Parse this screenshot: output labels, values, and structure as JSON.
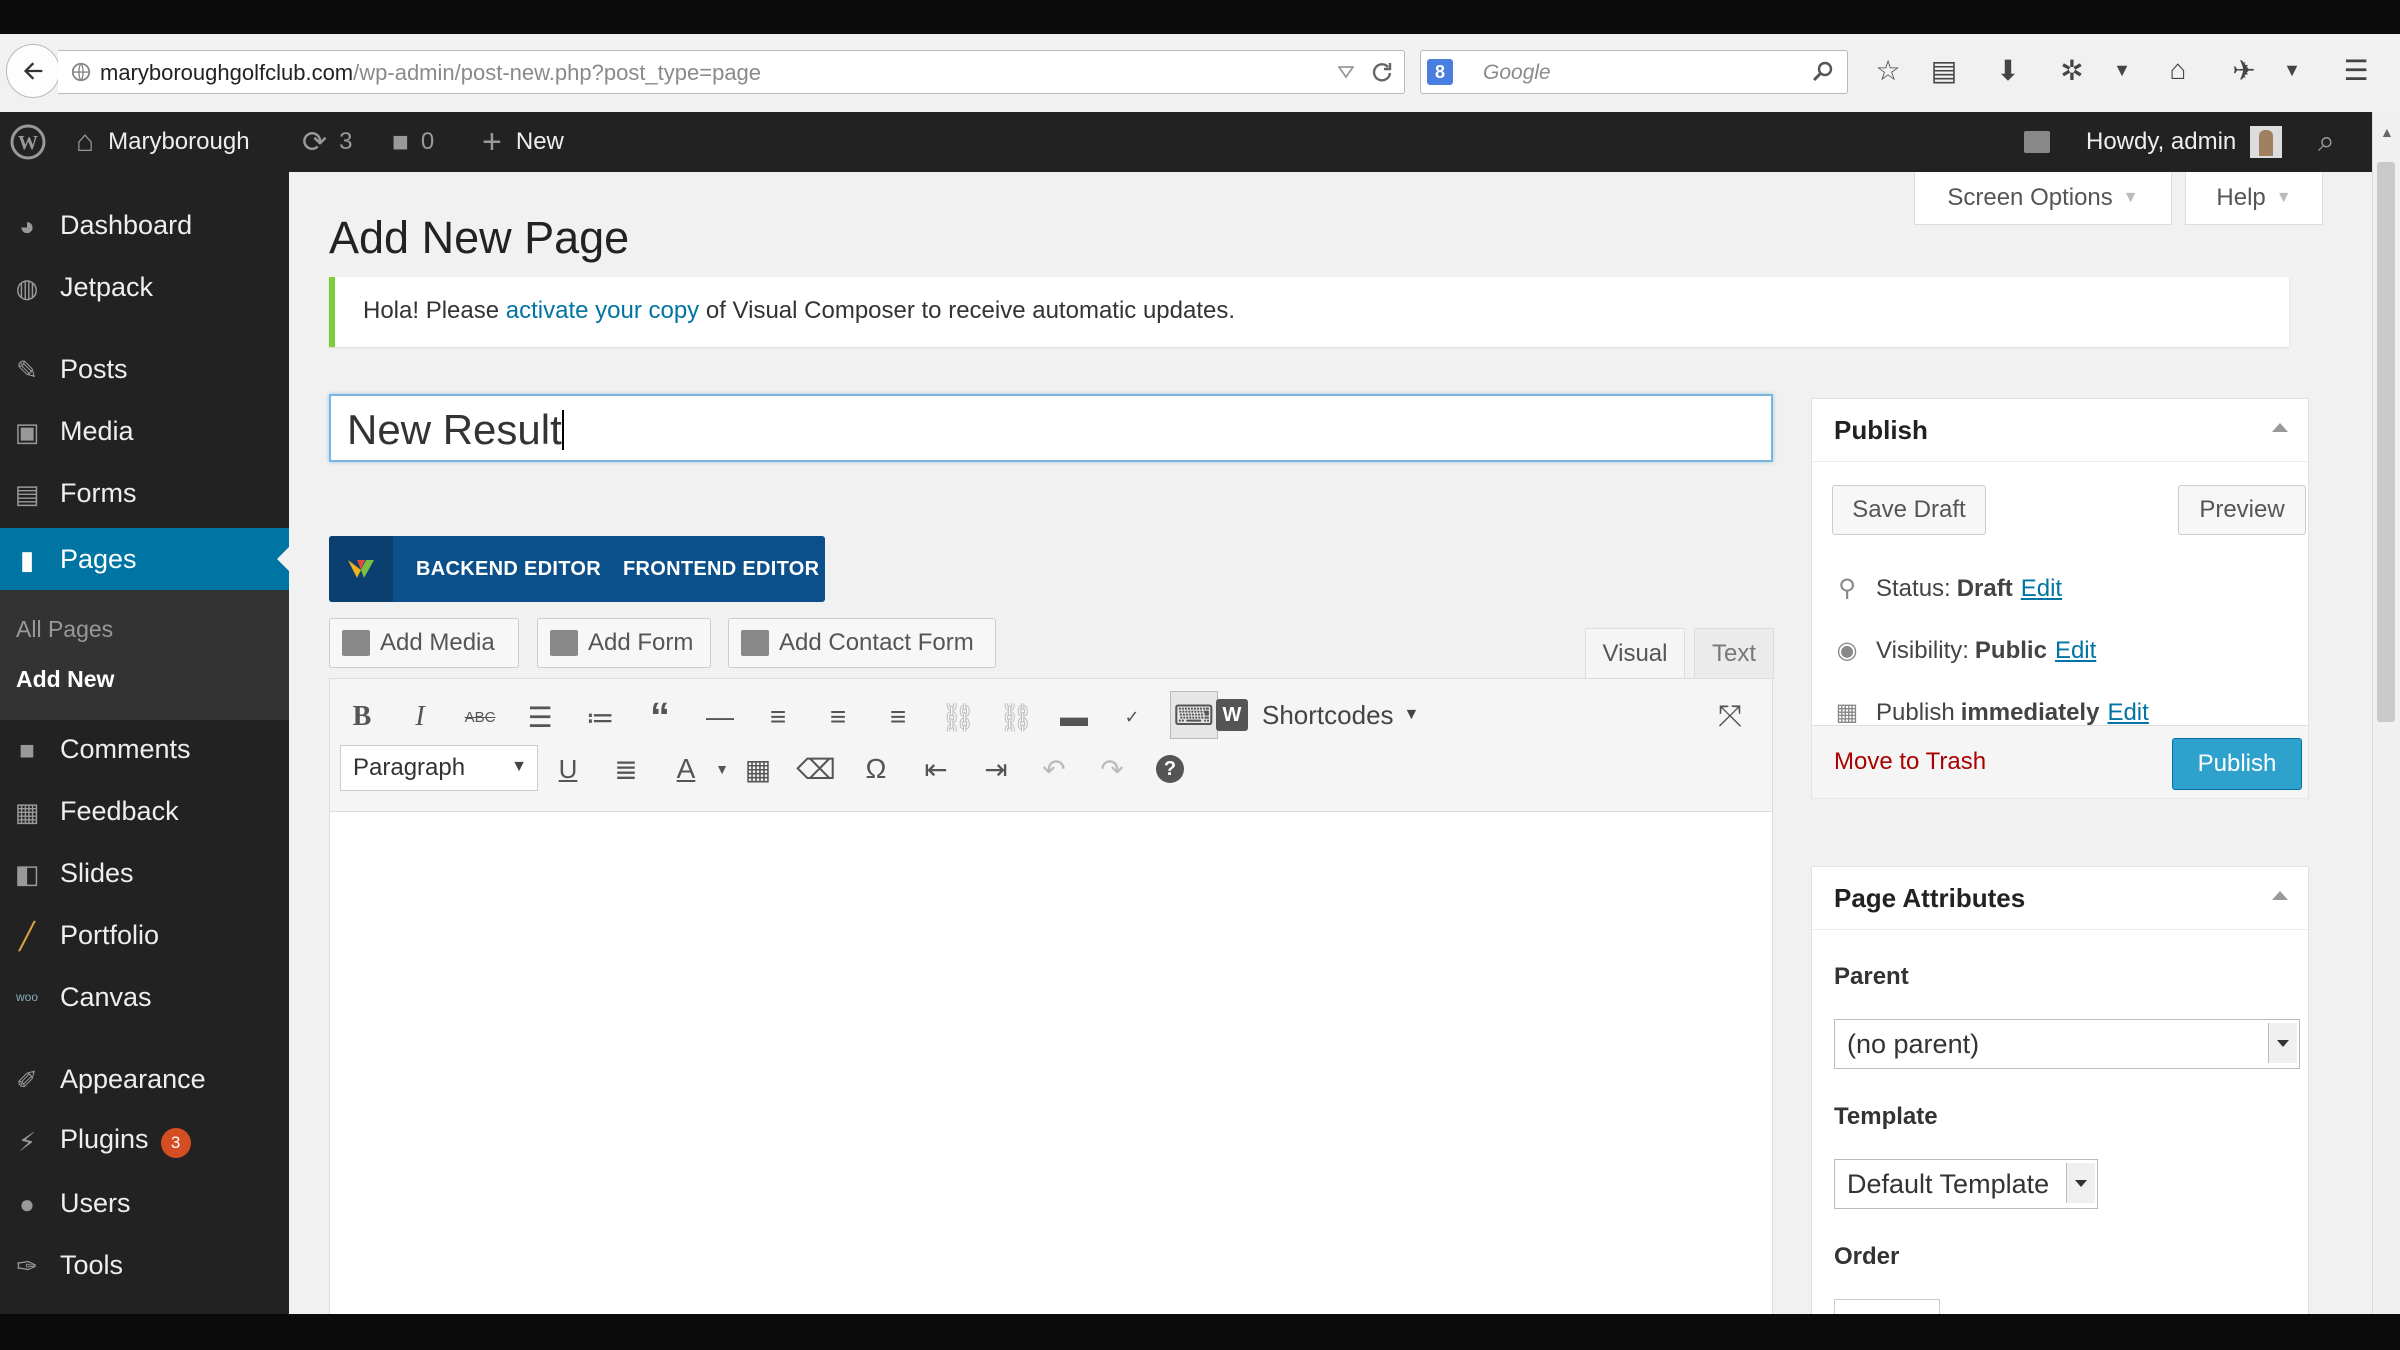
{
  "browser": {
    "url_domain": "maryboroughgolfclub.com",
    "url_path": "/wp-admin/post-new.php?post_type=page",
    "search_placeholder": "Google",
    "search_engine_label": "8"
  },
  "adminbar": {
    "site_name": "Maryborough",
    "updates_count": "3",
    "comments_count": "0",
    "new_label": "New",
    "howdy": "Howdy, admin"
  },
  "sidebar": {
    "items": [
      {
        "label": "Dashboard",
        "icon": "dashboard-icon"
      },
      {
        "label": "Jetpack",
        "icon": "jetpack-icon"
      },
      {
        "label": "Posts",
        "icon": "pin-icon"
      },
      {
        "label": "Media",
        "icon": "media-icon"
      },
      {
        "label": "Forms",
        "icon": "forms-icon"
      },
      {
        "label": "Pages",
        "icon": "pages-icon"
      },
      {
        "label": "Comments",
        "icon": "comment-icon"
      },
      {
        "label": "Feedback",
        "icon": "feedback-icon"
      },
      {
        "label": "Slides",
        "icon": "slides-icon"
      },
      {
        "label": "Portfolio",
        "icon": "portfolio-icon"
      },
      {
        "label": "Canvas",
        "icon": "woo-icon"
      },
      {
        "label": "Appearance",
        "icon": "brush-icon"
      },
      {
        "label": "Plugins",
        "icon": "plugin-icon"
      },
      {
        "label": "Users",
        "icon": "user-icon"
      },
      {
        "label": "Tools",
        "icon": "wrench-icon"
      }
    ],
    "submenu": {
      "all_pages": "All Pages",
      "add_new": "Add New"
    },
    "plugins_badge": "3"
  },
  "screen_options": {
    "screen_options_label": "Screen Options",
    "help_label": "Help"
  },
  "page": {
    "title": "Add New Page",
    "notice_before": "Hola! Please ",
    "notice_link": "activate your copy",
    "notice_after": " of Visual Composer to receive automatic updates.",
    "post_title_value": "New Result"
  },
  "visual_composer": {
    "backend_label": "BACKEND EDITOR",
    "frontend_label": "FRONTEND EDITOR"
  },
  "media_buttons": {
    "add_media": "Add Media",
    "add_form": "Add Form",
    "add_contact_form": "Add Contact Form"
  },
  "editor_tabs": {
    "visual": "Visual",
    "text": "Text"
  },
  "toolbar": {
    "shortcodes_label": "Shortcodes",
    "format_value": "Paragraph"
  },
  "publish_box": {
    "title": "Publish",
    "save_draft": "Save Draft",
    "preview": "Preview",
    "status_label": "Status:",
    "status_value": "Draft",
    "visibility_label": "Visibility:",
    "visibility_value": "Public",
    "publish_label": "Publish",
    "publish_value": "immediately",
    "edit_link": "Edit",
    "move_to_trash": "Move to Trash",
    "publish_button": "Publish"
  },
  "page_attributes": {
    "title": "Page Attributes",
    "parent_label": "Parent",
    "parent_value": "(no parent)",
    "template_label": "Template",
    "template_value": "Default Template",
    "order_label": "Order"
  },
  "colors": {
    "admin_dark": "#222222",
    "accent_blue": "#0074a2",
    "button_blue": "#2ea2cc",
    "notice_green": "#7ad03a",
    "vc_blue": "#0b4f8b",
    "trash_red": "#aa0000"
  }
}
